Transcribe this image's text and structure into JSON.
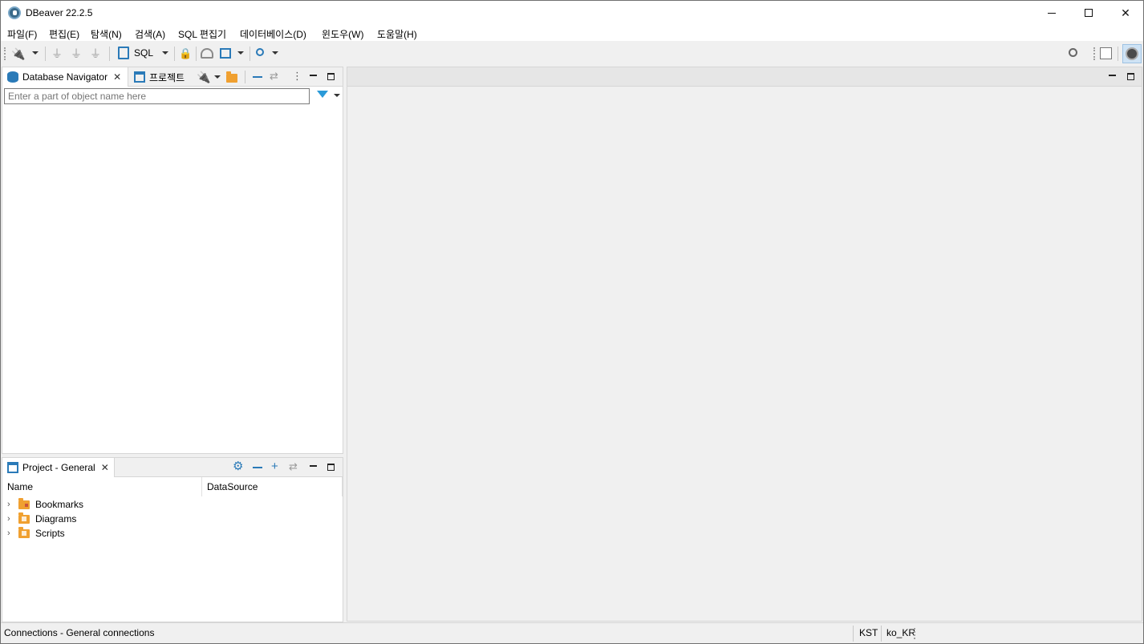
{
  "window": {
    "title": "DBeaver 22.2.5"
  },
  "menu": {
    "items": [
      "파일(F)",
      "편집(E)",
      "탐색(N)",
      "검색(A)",
      "SQL 편집기",
      "데이터베이스(D)",
      "윈도우(W)",
      "도움말(H)"
    ]
  },
  "toolbar": {
    "sql_label": "SQL",
    "icons": [
      "new-connection-icon",
      "connect-icon",
      "disconnect-icon",
      "disconnect-all-icon",
      "sql-editor-icon",
      "transaction-lock-icon",
      "dashboard-icon",
      "schema-compare-icon",
      "search-icon",
      "global-search-icon",
      "new-perspective-icon",
      "dbeaver-perspective-icon"
    ]
  },
  "navigator": {
    "tab_label": "Database Navigator",
    "projects_tab_label": "프로젝트",
    "filter_placeholder": "Enter a part of object name here"
  },
  "project_panel": {
    "tab_label": "Project - General",
    "columns": [
      "Name",
      "DataSource"
    ],
    "items": [
      {
        "label": "Bookmarks",
        "icon": "bookmarks-folder-icon"
      },
      {
        "label": "Diagrams",
        "icon": "diagrams-folder-icon"
      },
      {
        "label": "Scripts",
        "icon": "scripts-folder-icon"
      }
    ]
  },
  "status": {
    "left_text": "Connections - General connections",
    "timezone": "KST",
    "locale": "ko_KR"
  },
  "colors": {
    "accent_blue": "#2a7ab8",
    "folder_orange": "#f0a030",
    "chrome_bg": "#f0f0f0"
  }
}
